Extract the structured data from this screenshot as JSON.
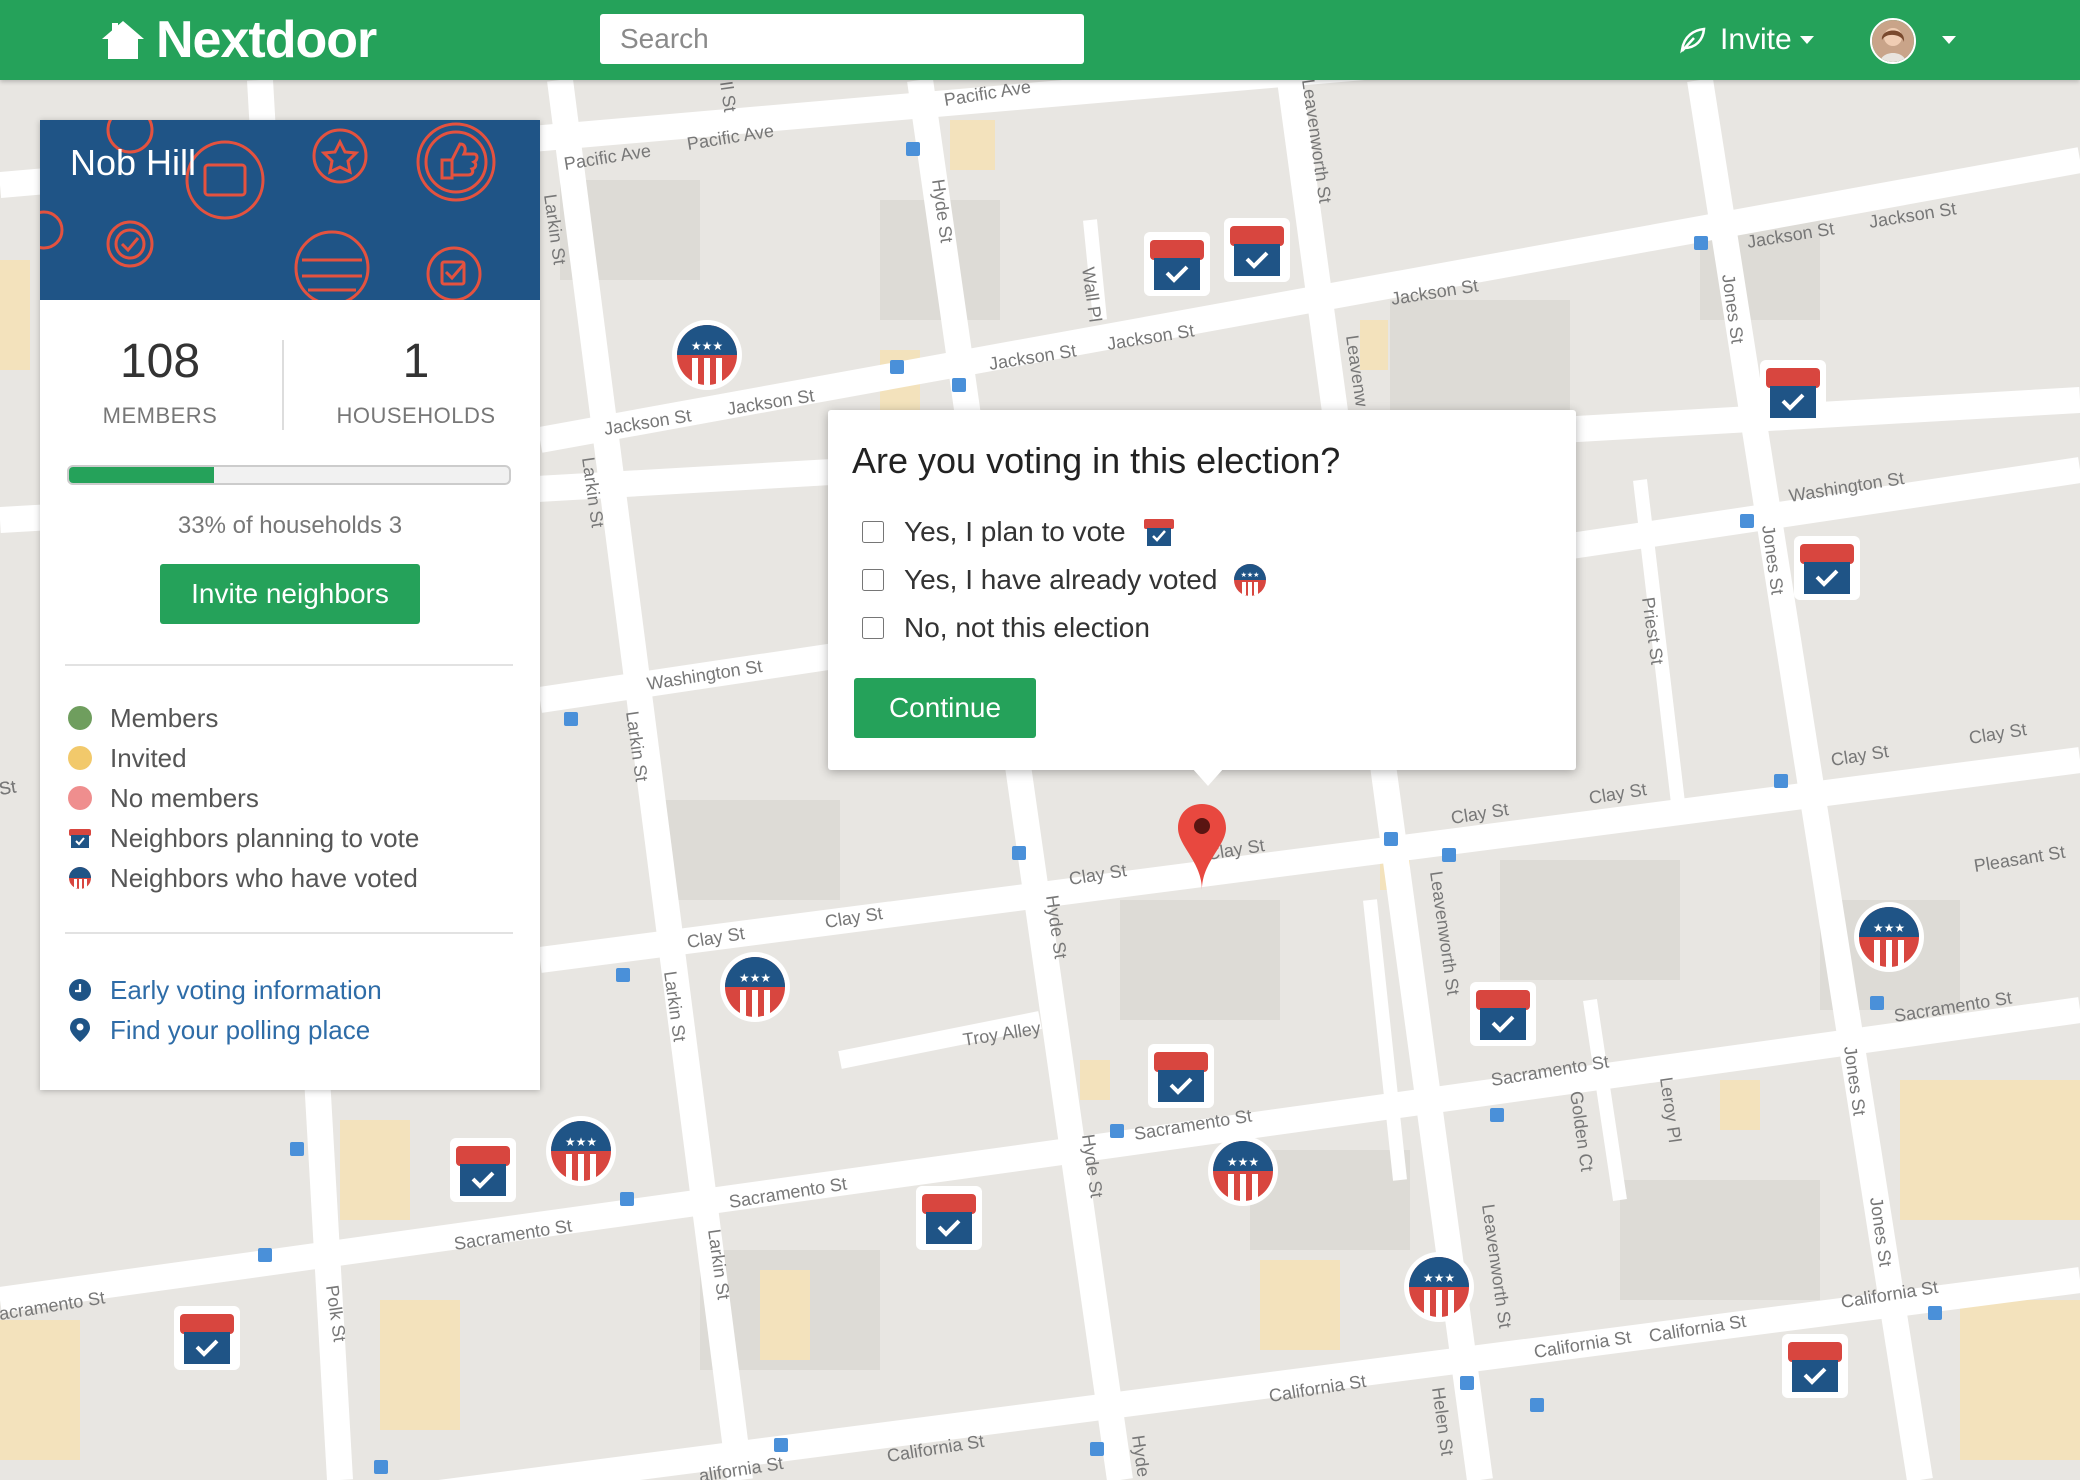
{
  "brand": {
    "name": "Nextdoor"
  },
  "search": {
    "placeholder": "Search"
  },
  "nav": {
    "invite_label": "Invite"
  },
  "neighborhood": {
    "name": "Nob Hill",
    "members_count": "108",
    "members_label": "MEMBERS",
    "households_count": "1",
    "households_label": "HOUSEHOLDS",
    "progress_fraction": 0.33,
    "progress_text": "33% of households 3",
    "invite_button": "Invite neighbors"
  },
  "legend": {
    "members": "Members",
    "invited": "Invited",
    "no_members": "No members",
    "planning": "Neighbors planning to vote",
    "voted": "Neighbors who have voted"
  },
  "links": {
    "early_voting": "Early voting information",
    "polling_place": "Find your polling place"
  },
  "popup": {
    "question": "Are you voting in this election?",
    "options": [
      "Yes, I plan to vote",
      "Yes, I have already voted",
      "No, not this election"
    ],
    "continue": "Continue"
  },
  "colors": {
    "brand_green": "#25a25a",
    "banner_blue": "#1f5486",
    "ballot_red": "#d8463f",
    "ballot_blue": "#1f5486",
    "link_blue": "#2e6ca7"
  },
  "map_labels": {
    "pacific_ave_1": "Pacific Ave",
    "pacific_ave_2": "Pacific Ave",
    "pacific_ave_3": "Pacific Ave",
    "jackson_st_1": "Jackson St",
    "jackson_st_2": "Jackson St",
    "jackson_st_3": "Jackson St",
    "jackson_st_4": "Jackson St",
    "jackson_st_5": "Jackson St",
    "jackson_st_6": "Jackson St",
    "jackson_st_7": "Jackson St",
    "washington_st_1": "Washington St",
    "washington_st_2": "Washington St",
    "clay_st_1": "Clay St",
    "clay_st_2": "Clay St",
    "clay_st_3": "Clay St",
    "clay_st_4": "Clay St",
    "clay_st_5": "Clay St",
    "clay_st_6": "Clay St",
    "clay_st_7": "Clay St",
    "clay_st_8": "Clay St",
    "clay_st_9": "St",
    "sacramento_st_1": "Sacramento St",
    "sacramento_st_2": "Sacramento St",
    "sacramento_st_3": "Sacramento St",
    "sacramento_st_4": "Sacramento St",
    "sacramento_st_5": "Sacramento St",
    "sacramento_st_6": "acramento St",
    "california_st_1": "California St",
    "california_st_2": "California St",
    "california_st_3": "California St",
    "california_st_4": "California St",
    "california_st_5": "California St",
    "california_st_6": "alifornia St",
    "pleasant_st": "Pleasant St",
    "troy_alley": "Troy Alley",
    "larkin_st_1": "Larkin St",
    "larkin_st_2": "Larkin St",
    "larkin_st_3": "Larkin St",
    "larkin_st_4": "Larkin St",
    "larkin_st_5": "Larkin St",
    "hyde_st_1": "Hyde St",
    "hyde_st_2": "Hyde St",
    "hyde_st_3": "Hyde St",
    "hyde_st_4": "Hyde",
    "leavenworth_st_1": "Leavenworth St",
    "leavenworth_st_2": "Leavenworth St",
    "leavenworth_st_3": "Leavenworth St",
    "leavenworth_st_4": "Leavenw",
    "jones_st_1": "Jones St",
    "jones_st_2": "Jones St",
    "jones_st_3": "Jones St",
    "jones_st_4": "Jones St",
    "wall_pl": "Wall Pl",
    "priest_st": "Priest St",
    "golden_ct": "Golden Ct",
    "leroy_pl": "Leroy Pl",
    "helen_st": "Helen St",
    "polk_st": "Polk St",
    "partial_st": "St",
    "partial_st_2": "Il St"
  }
}
